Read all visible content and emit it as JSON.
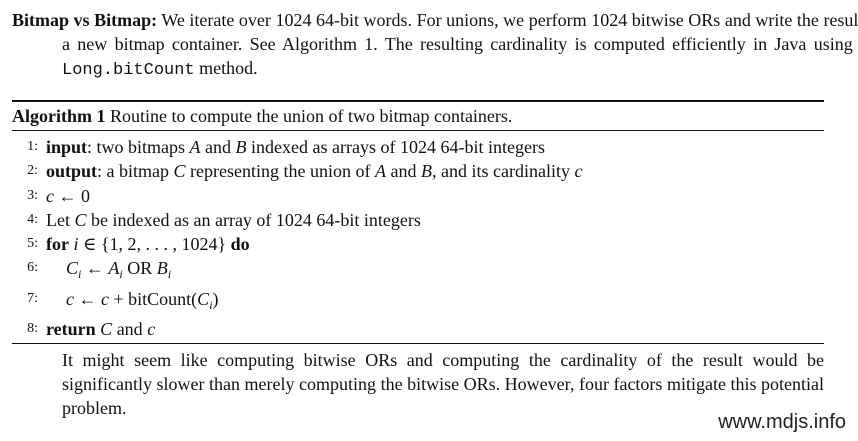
{
  "intro": {
    "label": "Bitmap vs Bitmap:",
    "text1": "We iterate over 1024 64-bit words. For unions, we perform 1024 bitwise ORs and write the result to a new bitmap container. See Algorithm 1. The resulting cardinality is computed efficiently in Java using the",
    "code": "Long.bitCount",
    "text2": "method."
  },
  "algorithm": {
    "label": "Algorithm 1",
    "caption": "Routine to compute the union of two bitmap containers.",
    "lines": [
      {
        "num": "1:",
        "kw": "input",
        "text": ": two bitmaps",
        "A": "A",
        "and": "and",
        "B": "B",
        "rest": "indexed as arrays of 1024 64-bit integers"
      },
      {
        "num": "2:",
        "kw": "output",
        "text": ": a bitmap",
        "C": "C",
        "rest": "representing the union of",
        "A": "A",
        "and": "and",
        "B": "B",
        "rest2": ", and its cardinality",
        "c": "c"
      },
      {
        "num": "3:",
        "lhs": "c",
        "arrow": "←",
        "rhs": "0"
      },
      {
        "num": "4:",
        "text": "Let",
        "C": "C",
        "rest": "be indexed as an array of 1024 64-bit integers"
      },
      {
        "num": "5:",
        "kw": "for",
        "var": "i",
        "in": "∈",
        "set": "{1, 2, . . . , 1024}",
        "kw2": "do"
      },
      {
        "num": "6:",
        "lhs": "C",
        "lhs_sub": "i",
        "arrow": "←",
        "a": "A",
        "a_sub": "i",
        "op": "OR",
        "b": "B",
        "b_sub": "i"
      },
      {
        "num": "7:",
        "lhs": "c",
        "arrow": "←",
        "rhs": "c",
        "plus": "+",
        "fn": "bitCount(",
        "arg": "C",
        "arg_sub": "i",
        "close": ")"
      },
      {
        "num": "8:",
        "kw": "return",
        "C": "C",
        "and": "and",
        "c": "c"
      }
    ]
  },
  "closing": {
    "text": "It might seem like computing bitwise ORs and computing the cardinality of the result would be significantly slower than merely computing the bitwise ORs. However, four factors mitigate this potential problem."
  },
  "watermark": "www.mdjs.info"
}
